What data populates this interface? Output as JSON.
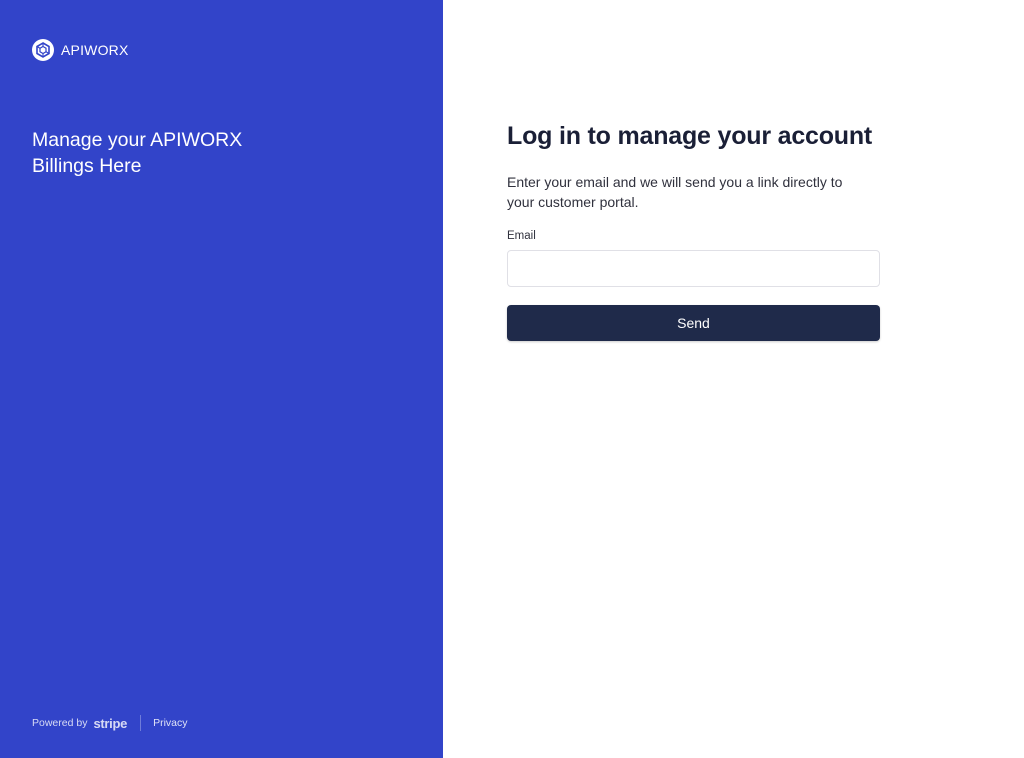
{
  "brand": {
    "name": "APIWORX",
    "logo_icon": "hexagon-logo-icon"
  },
  "left_panel": {
    "headline_line1": "Manage your APIWORX",
    "headline_line2": "Billings Here",
    "background_color": "#3244c9"
  },
  "footer": {
    "powered_by": "Powered by",
    "stripe": "stripe",
    "privacy": "Privacy"
  },
  "form": {
    "title": "Log in to manage your account",
    "subtitle": "Enter your email and we will send you a link directly to your customer portal.",
    "email_label": "Email",
    "email_value": "",
    "email_placeholder": "",
    "send_label": "Send",
    "button_color": "#1f2a4a"
  }
}
